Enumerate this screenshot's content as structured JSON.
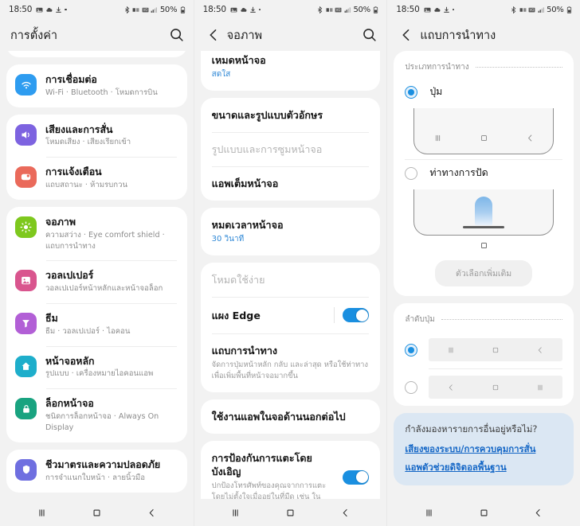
{
  "status_bar": {
    "time": "18:50",
    "battery_pct": "50%",
    "left_icons": [
      "image-icon",
      "cloud-icon",
      "download-icon",
      "dot-icon"
    ],
    "right_icons": [
      "bluetooth-icon",
      "network-icon",
      "wifi-calling-icon",
      "signal-icon",
      "battery-icon"
    ]
  },
  "nav_bar": {
    "recents": "|||",
    "home": "□",
    "back": "‹"
  },
  "screen1": {
    "title": "การตั้งค่า",
    "search_icon": "search-icon",
    "groups": [
      {
        "items": [
          {
            "title": "การเชื่อมต่อ",
            "sub": "Wi-Fi · Bluetooth · โหมดการบิน",
            "icon": "wifi-icon",
            "color": "#2e9cf0"
          }
        ]
      },
      {
        "items": [
          {
            "title": "เสียงและการสั่น",
            "sub": "โหมดเสียง · เสียงเรียกเข้า",
            "icon": "volume-icon",
            "color": "#7d63e0"
          },
          {
            "title": "การแจ้งเตือน",
            "sub": "แถบสถานะ · ห้ามรบกวน",
            "icon": "notification-icon",
            "color": "#ea6a5b"
          }
        ]
      },
      {
        "items": [
          {
            "title": "จอภาพ",
            "sub": "ความสว่าง · Eye comfort shield · แถบการนำทาง",
            "icon": "brightness-icon",
            "color": "#7ec81e"
          },
          {
            "title": "วอลเปเปอร์",
            "sub": "วอลเปเปอร์หน้าหลักและหน้าจอล็อก",
            "icon": "wallpaper-icon",
            "color": "#d9558e"
          },
          {
            "title": "ธีม",
            "sub": "ธีม · วอลเปเปอร์ · ไอคอน",
            "icon": "theme-icon",
            "color": "#b25fd6"
          },
          {
            "title": "หน้าจอหลัก",
            "sub": "รูปแบบ · เครื่องหมายไอคอนแอพ",
            "icon": "home-screen-icon",
            "color": "#1eaecb"
          },
          {
            "title": "ล็อกหน้าจอ",
            "sub": "ชนิดการล็อกหน้าจอ · Always On Display",
            "icon": "lock-icon",
            "color": "#19a380"
          }
        ]
      },
      {
        "items": [
          {
            "title": "ชีวมาตรและความปลอดภัย",
            "sub": "การจำแนกใบหน้า · ลายนิ้วมือ",
            "icon": "shield-icon",
            "color": "#6f6fe0"
          }
        ]
      }
    ]
  },
  "screen2": {
    "title": "จอภาพ",
    "back_icon": "back-icon",
    "search_icon": "search-icon",
    "cards": [
      {
        "rows": [
          {
            "title": "เหมดหน้าจอ",
            "value": "สดใส"
          }
        ]
      },
      {
        "rows": [
          {
            "title": "ขนาดและรูปแบบตัวอักษร"
          },
          {
            "title": "รูปแบบและการซูมหน้าจอ",
            "dim": true
          },
          {
            "title": "แอพเต็มหน้าจอ"
          }
        ]
      },
      {
        "rows": [
          {
            "title": "หมดเวลาหน้าจอ",
            "value": "30 วินาที"
          }
        ]
      },
      {
        "rows": [
          {
            "title": "โหมดใช้ง่าย",
            "dim": true
          },
          {
            "title": "แผง Edge",
            "toggle": true
          },
          {
            "title": "แถบการนำทาง",
            "desc": "จัดการปุ่มหน้าหลัก กลับ และล่าสุด หรือใช้ท่าทางเพื่อเพิ่มพื้นที่หน้าจอมากขึ้น"
          }
        ]
      },
      {
        "rows": [
          {
            "title": "ใช้งานแอพในจอด้านนอกต่อไป"
          }
        ]
      },
      {
        "rows": [
          {
            "title": "การป้องกันการแตะโดยบังเอิญ",
            "desc": "ปกป้องโทรศัพท์ของคุณจากการแตะโดยไม่ตั้งใจเมื่ออยู่ในที่มืด เช่น ใน",
            "toggle": true
          }
        ]
      }
    ]
  },
  "screen3": {
    "title": "แถบการนำทาง",
    "back_icon": "back-icon",
    "nav_type_label": "ประเภทการนำทาง",
    "option_buttons": "ปุ่ม",
    "option_gestures": "ท่าทางการปัด",
    "more_options": "ตัวเลือกเพิ่มเติม",
    "button_order_label": "ลำดับปุ่ม",
    "order_option_1": [
      "|||",
      "□",
      "‹"
    ],
    "order_option_2": [
      "‹",
      "□",
      "|||"
    ],
    "selected_nav_type": 0,
    "selected_order": 0,
    "tip": {
      "question": "กำลังมองหารายการอื่นอยู่หรือไม่?",
      "links": [
        "เสียงของระบบ/การควบคุมการสั่น",
        "แอพตัวช่วยดิจิตอลพื้นฐาน"
      ]
    }
  },
  "colors": {
    "accent_blue": "#1a8fe0",
    "link_blue": "#1567c6",
    "tip_bg": "#dbe7f3",
    "page_bg": "#f2f2f2",
    "card_bg": "#ffffff"
  }
}
